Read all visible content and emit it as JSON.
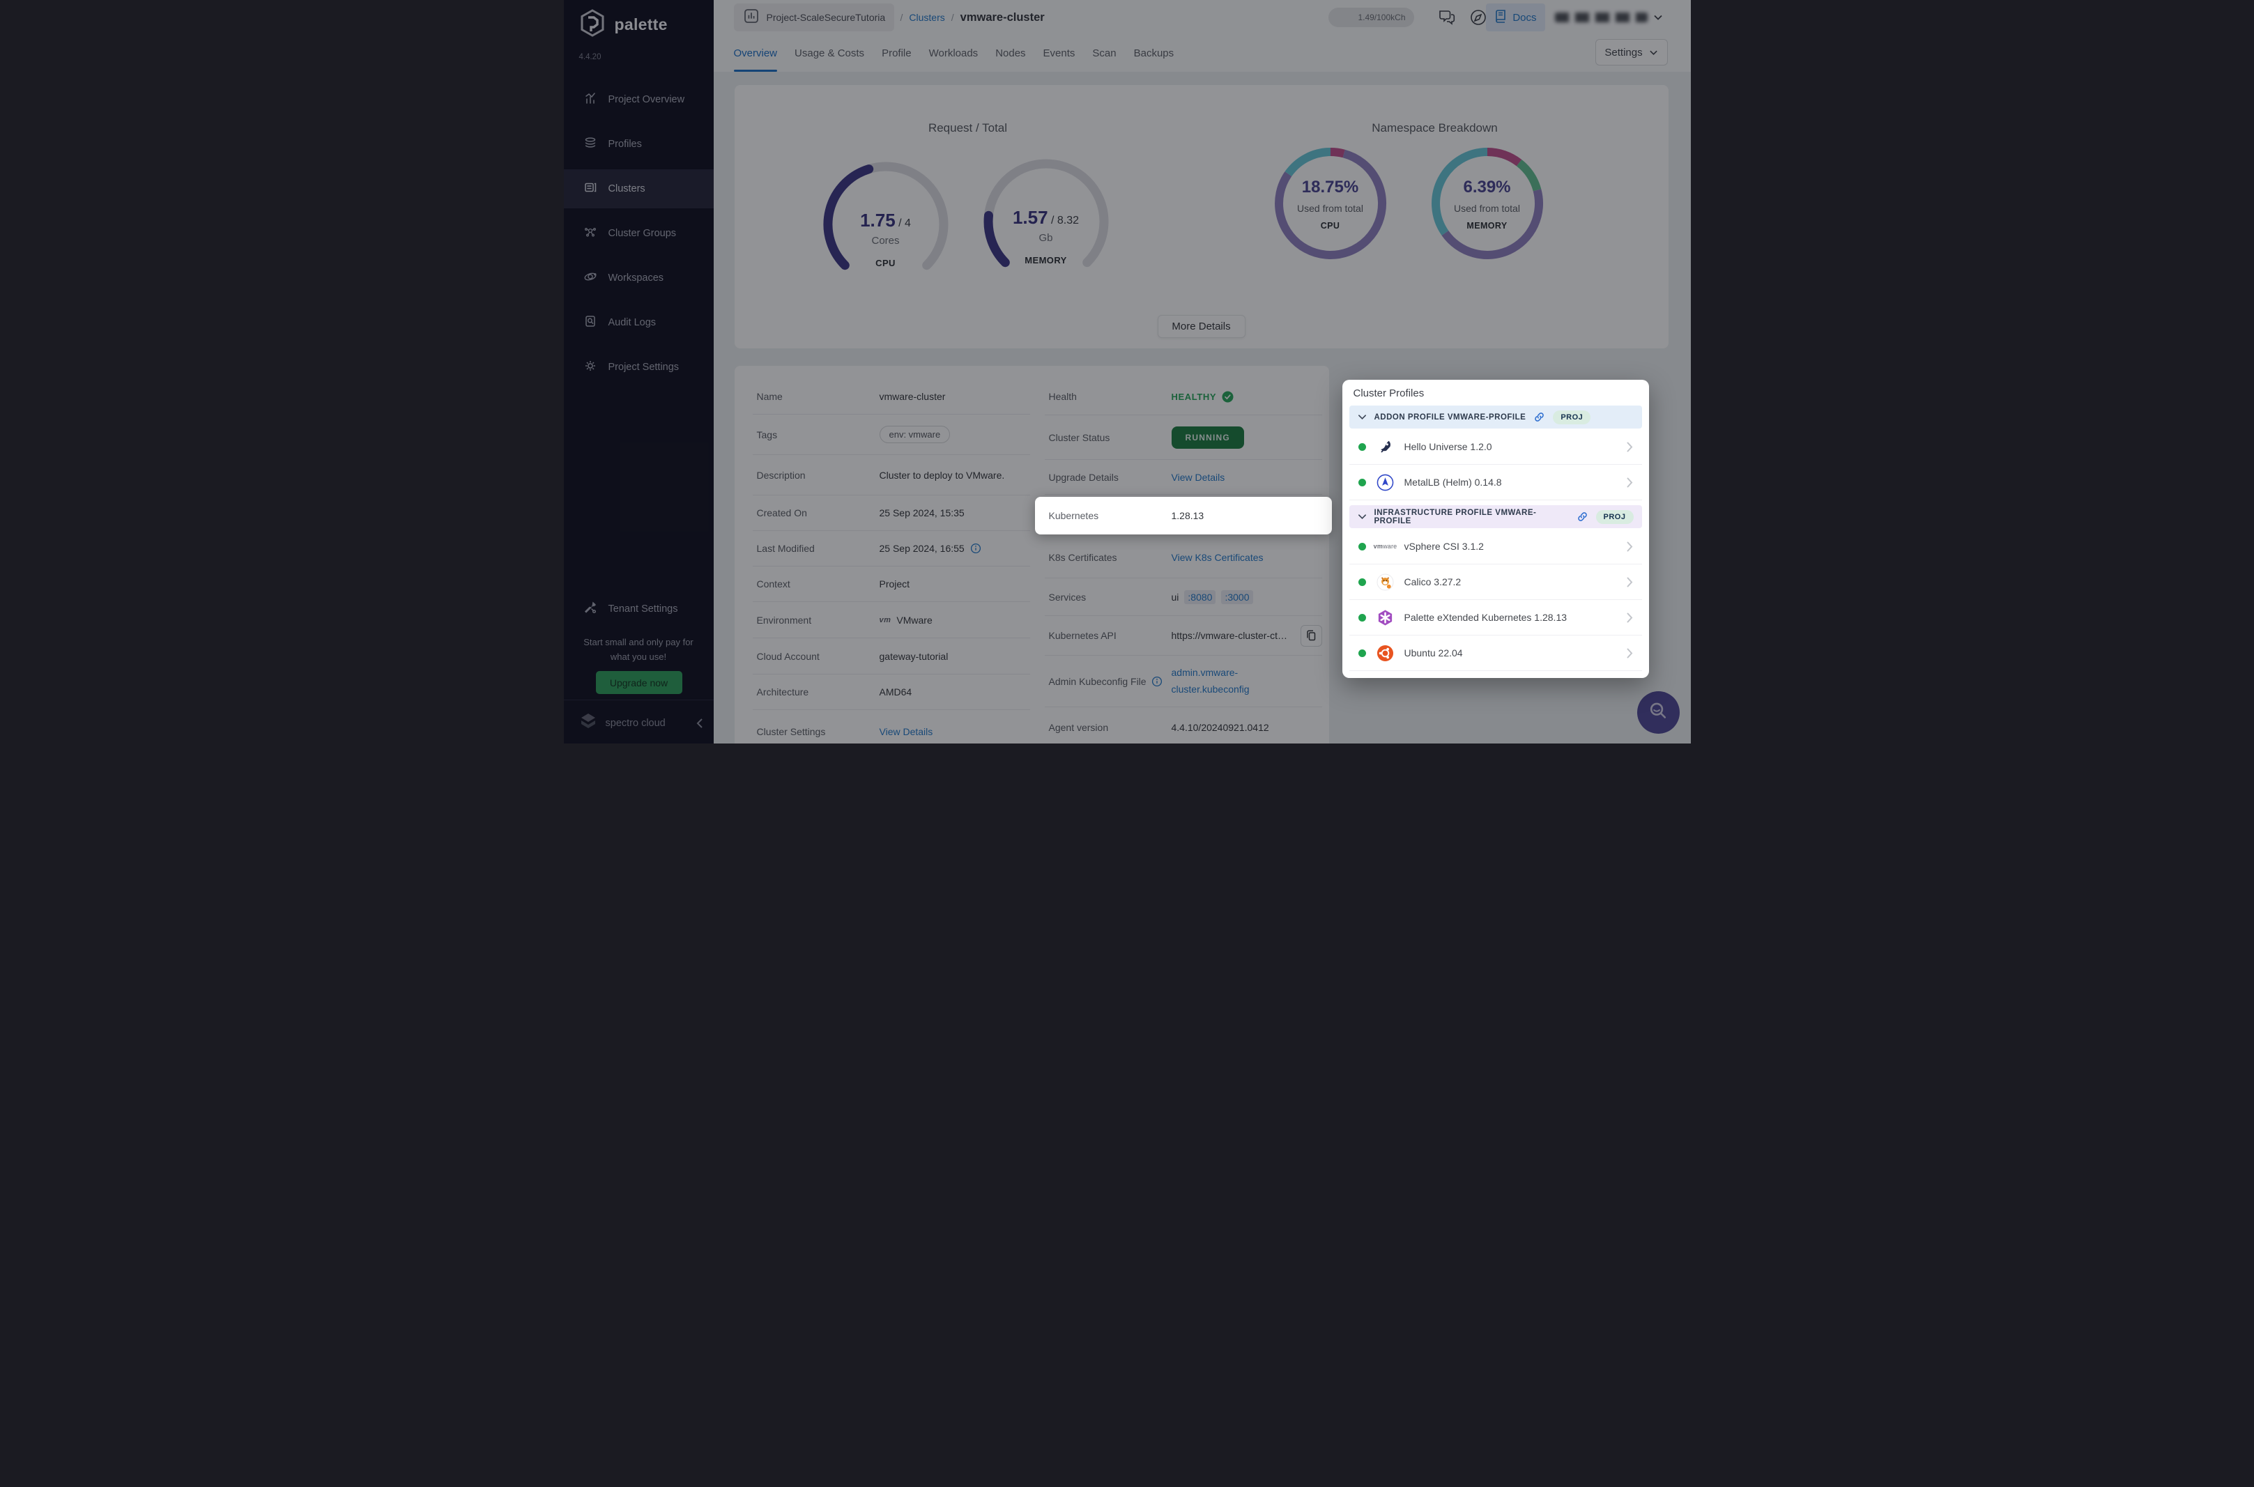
{
  "brand": {
    "name": "palette",
    "version": "4.4.20"
  },
  "sidebar": {
    "items": [
      {
        "label": "Project Overview",
        "icon": "chart-icon",
        "active": false
      },
      {
        "label": "Profiles",
        "icon": "layers-icon",
        "active": false
      },
      {
        "label": "Clusters",
        "icon": "clusters-icon",
        "active": true
      },
      {
        "label": "Cluster Groups",
        "icon": "cluster-groups-icon",
        "active": false
      },
      {
        "label": "Workspaces",
        "icon": "workspaces-icon",
        "active": false
      },
      {
        "label": "Audit Logs",
        "icon": "audit-logs-icon",
        "active": false
      },
      {
        "label": "Project Settings",
        "icon": "gear-icon",
        "active": false
      }
    ],
    "tenant_settings": {
      "label": "Tenant Settings",
      "icon": "tools-icon"
    },
    "promo": {
      "text": "Start small and only pay for what you use!",
      "cta": "Upgrade now"
    },
    "footer": {
      "brand": "spectro cloud"
    }
  },
  "topbar": {
    "project": "Project-ScaleSecureTutoria",
    "breadcrumb": {
      "separator": "/",
      "link": "Clusters",
      "current": "vmware-cluster"
    },
    "credits": "1.49/100kCh",
    "docs_label": "Docs"
  },
  "tabs": {
    "items": [
      "Overview",
      "Usage & Costs",
      "Profile",
      "Workloads",
      "Nodes",
      "Events",
      "Scan",
      "Backups"
    ],
    "active": "Overview",
    "settings_label": "Settings"
  },
  "overview_card": {
    "request_total": {
      "title": "Request / Total",
      "cpu": {
        "value": "1.75",
        "total": "/ 4",
        "unit": "Cores",
        "label": "CPU",
        "percent": 43.75
      },
      "memory": {
        "value": "1.57",
        "total": "/ 8.32",
        "unit": "Gb",
        "label": "MEMORY",
        "percent": 18.87
      }
    },
    "namespace": {
      "title": "Namespace Breakdown",
      "cpu": {
        "percent": "18.75%",
        "caption": "Used from total",
        "label": "CPU"
      },
      "memory": {
        "percent": "6.39%",
        "caption": "Used from total",
        "label": "MEMORY"
      }
    },
    "more_details": "More Details"
  },
  "details": {
    "left": [
      {
        "label": "Name",
        "kind": "text",
        "value": "vmware-cluster"
      },
      {
        "label": "Tags",
        "kind": "tag",
        "value": "env: vmware"
      },
      {
        "label": "Description",
        "kind": "text",
        "value": "Cluster to deploy to VMware."
      },
      {
        "label": "Created On",
        "kind": "text",
        "value": "25 Sep 2024, 15:35"
      },
      {
        "label": "Last Modified",
        "kind": "text-info",
        "value": "25 Sep 2024, 16:55"
      },
      {
        "label": "Context",
        "kind": "text",
        "value": "Project"
      },
      {
        "label": "Environment",
        "kind": "env",
        "value": "VMware",
        "icon": "vmware-logo-icon"
      },
      {
        "label": "Cloud Account",
        "kind": "text",
        "value": "gateway-tutorial"
      },
      {
        "label": "Architecture",
        "kind": "text",
        "value": "AMD64"
      },
      {
        "label": "Cluster Settings",
        "kind": "link",
        "value": "View Details"
      }
    ],
    "right": [
      {
        "label": "Health",
        "kind": "health",
        "value": "HEALTHY"
      },
      {
        "label": "Cluster Status",
        "kind": "status",
        "value": "RUNNING"
      },
      {
        "label": "Upgrade Details",
        "kind": "link",
        "value": "View Details"
      },
      {
        "label": "Kubernetes",
        "kind": "spotlight",
        "value": "1.28.13"
      },
      {
        "label": "K8s Certificates",
        "kind": "link",
        "value": "View K8s Certificates"
      },
      {
        "label": "Services",
        "kind": "services",
        "prefix": "ui",
        "ports": [
          ":8080",
          ":3000"
        ]
      },
      {
        "label": "Kubernetes API",
        "kind": "api",
        "value": "https://vmware-cluster-ct…"
      },
      {
        "label": "Admin Kubeconfig File",
        "kind": "kubeconfig",
        "value_lines": [
          "admin.vmware-",
          "cluster.kubeconfig"
        ]
      },
      {
        "label": "Agent version",
        "kind": "text",
        "value": "4.4.10/20240921.0412"
      }
    ]
  },
  "cluster_profiles": {
    "title": "Cluster Profiles",
    "sections": [
      {
        "kind": "addon",
        "header": "ADDON PROFILE VMWARE-PROFILE",
        "badge": "PROJ",
        "items": [
          {
            "name": "Hello Universe 1.2.0",
            "icon": "hello-universe-icon"
          },
          {
            "name": "MetalLB (Helm) 0.14.8",
            "icon": "metallb-icon"
          }
        ]
      },
      {
        "kind": "infra",
        "header": "INFRASTRUCTURE PROFILE VMWARE-PROFILE",
        "badge": "PROJ",
        "items": [
          {
            "name": "vSphere CSI 3.1.2",
            "icon": "vmware-icon"
          },
          {
            "name": "Calico 3.27.2",
            "icon": "calico-icon"
          },
          {
            "name": "Palette eXtended Kubernetes 1.28.13",
            "icon": "palette-xk-icon"
          },
          {
            "name": "Ubuntu 22.04",
            "icon": "ubuntu-icon"
          }
        ]
      }
    ]
  },
  "colors": {
    "accent_blue": "#1d6fc5",
    "link_blue": "#2479c8",
    "healthy_green": "#27a65a",
    "running_green": "#1d7c40",
    "gauge_indigo": "#3c3786",
    "donut_purple": "#8f80bf",
    "donut_teal": "#67c6d8",
    "donut_pink": "#bf4f8c",
    "donut_green": "#62bd90",
    "sidebar_bg": "#10101f",
    "upgrade_green": "#2e9e5b",
    "fab_purple": "#4f4796"
  }
}
